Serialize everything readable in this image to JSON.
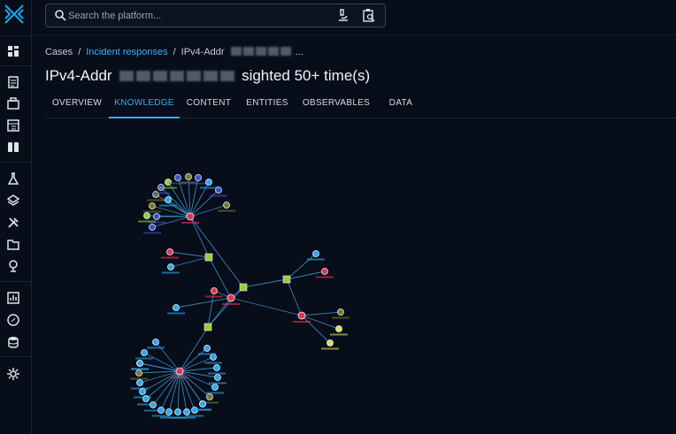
{
  "search": {
    "placeholder": "Search the platform..."
  },
  "breadcrumb": {
    "item1": "Cases",
    "item2": "Incident responses",
    "item3_prefix": "IPv4-Addr",
    "item3_suffix": "..."
  },
  "title": {
    "prefix": "IPv4-Addr",
    "suffix": "sighted 50+ time(s)"
  },
  "tabs": [
    "OVERVIEW",
    "KNOWLEDGE",
    "CONTENT",
    "ENTITIES",
    "OBSERVABLES",
    "DATA"
  ],
  "active_tab": "KNOWLEDGE",
  "sidebar_icons": [
    "dashboard-icon",
    "analyses-icon",
    "cases-icon",
    "events-icon",
    "observations-icon",
    "threats-icon",
    "arsenal-icon",
    "techniques-icon",
    "entities-icon",
    "locations-icon",
    "dashboards-icon",
    "investigations-icon",
    "data-icon",
    "settings-icon"
  ],
  "colors": {
    "accent": "#3ab0ef",
    "background": "#070d19",
    "incident": "#e8334a",
    "indicator": "#9acd32",
    "observable": "#2fa8ee"
  }
}
